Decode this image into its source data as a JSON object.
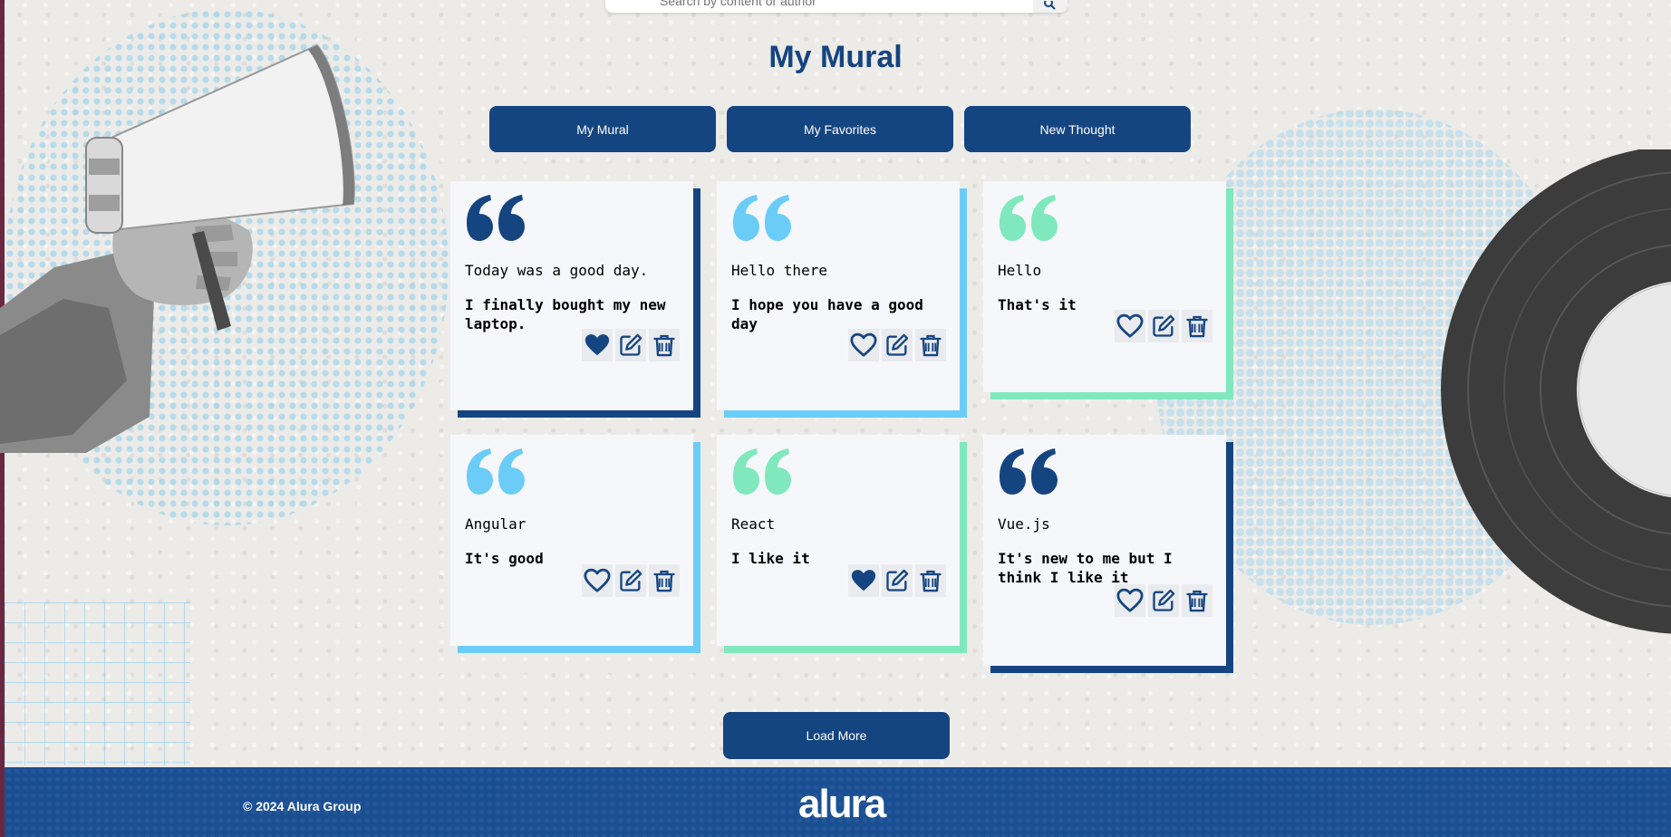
{
  "search": {
    "placeholder": "Search by content or author"
  },
  "page": {
    "title": "My Mural"
  },
  "nav": {
    "buttons": [
      {
        "label": "My Mural"
      },
      {
        "label": "My Favorites"
      },
      {
        "label": "New Thought"
      }
    ]
  },
  "cards": [
    {
      "text": "Today was a good day.",
      "author": "I finally bought my new laptop.",
      "accent": "#154580",
      "favorite": true
    },
    {
      "text": "Hello there",
      "author": "I hope you have a good day",
      "accent": "#6bcdf7",
      "favorite": false
    },
    {
      "text": "Hello",
      "author": "That's it",
      "accent": "#80e8bd",
      "favorite": false
    },
    {
      "text": "Angular",
      "author": "It's good",
      "accent": "#6bcdf7",
      "favorite": false
    },
    {
      "text": "React",
      "author": "I like it",
      "accent": "#80e8bd",
      "favorite": true
    },
    {
      "text": "Vue.js",
      "author": "It's new to me but I think I like it",
      "accent": "#154580",
      "favorite": false
    }
  ],
  "load_more": {
    "label": "Load More"
  },
  "footer": {
    "copyright": "© 2024 Alura Group",
    "logo": "alura"
  },
  "colors": {
    "primary": "#154580",
    "sky": "#6bcdf7",
    "mint": "#80e8bd",
    "card_bg": "#f5f7fb"
  },
  "icons": [
    "quote-icon",
    "heart-icon",
    "edit-icon",
    "trash-icon",
    "search-icon"
  ]
}
